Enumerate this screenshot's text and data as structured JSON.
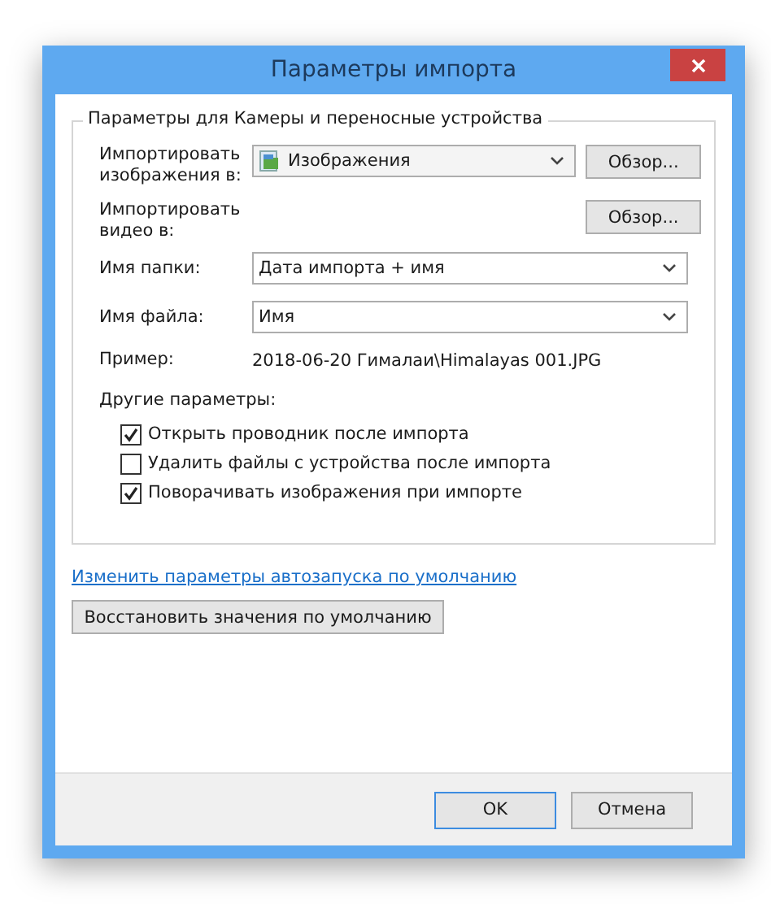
{
  "window": {
    "title": "Параметры импорта"
  },
  "group": {
    "title": "Параметры для Камеры и переносные устройства",
    "fields": [
      {
        "kind": "folder",
        "label": "Импортировать изображения в:",
        "value": "Изображения",
        "button": "Обзор..."
      },
      {
        "kind": "browse",
        "label": "Импортировать видео в:",
        "button": "Обзор..."
      },
      {
        "kind": "select",
        "label": "Имя папки:",
        "value": "Дата импорта + имя"
      },
      {
        "kind": "select",
        "label": "Имя файла:",
        "value": "Имя"
      },
      {
        "kind": "text",
        "label": "Пример:",
        "value": "2018-06-20 Гималаи\\Himalayas 001.JPG"
      }
    ],
    "options_label": "Другие параметры:",
    "options": [
      {
        "label": "Открыть проводник после импорта",
        "checked": true
      },
      {
        "label": "Удалить файлы с устройства после импорта",
        "checked": false
      },
      {
        "label": "Поворачивать изображения при импорте",
        "checked": true
      }
    ]
  },
  "link": "Изменить параметры автозапуска по умолчанию",
  "restore_button": "Восстановить значения по умолчанию",
  "buttons": [
    {
      "label": "OK",
      "default": true
    },
    {
      "label": "Отмена",
      "default": false
    }
  ]
}
